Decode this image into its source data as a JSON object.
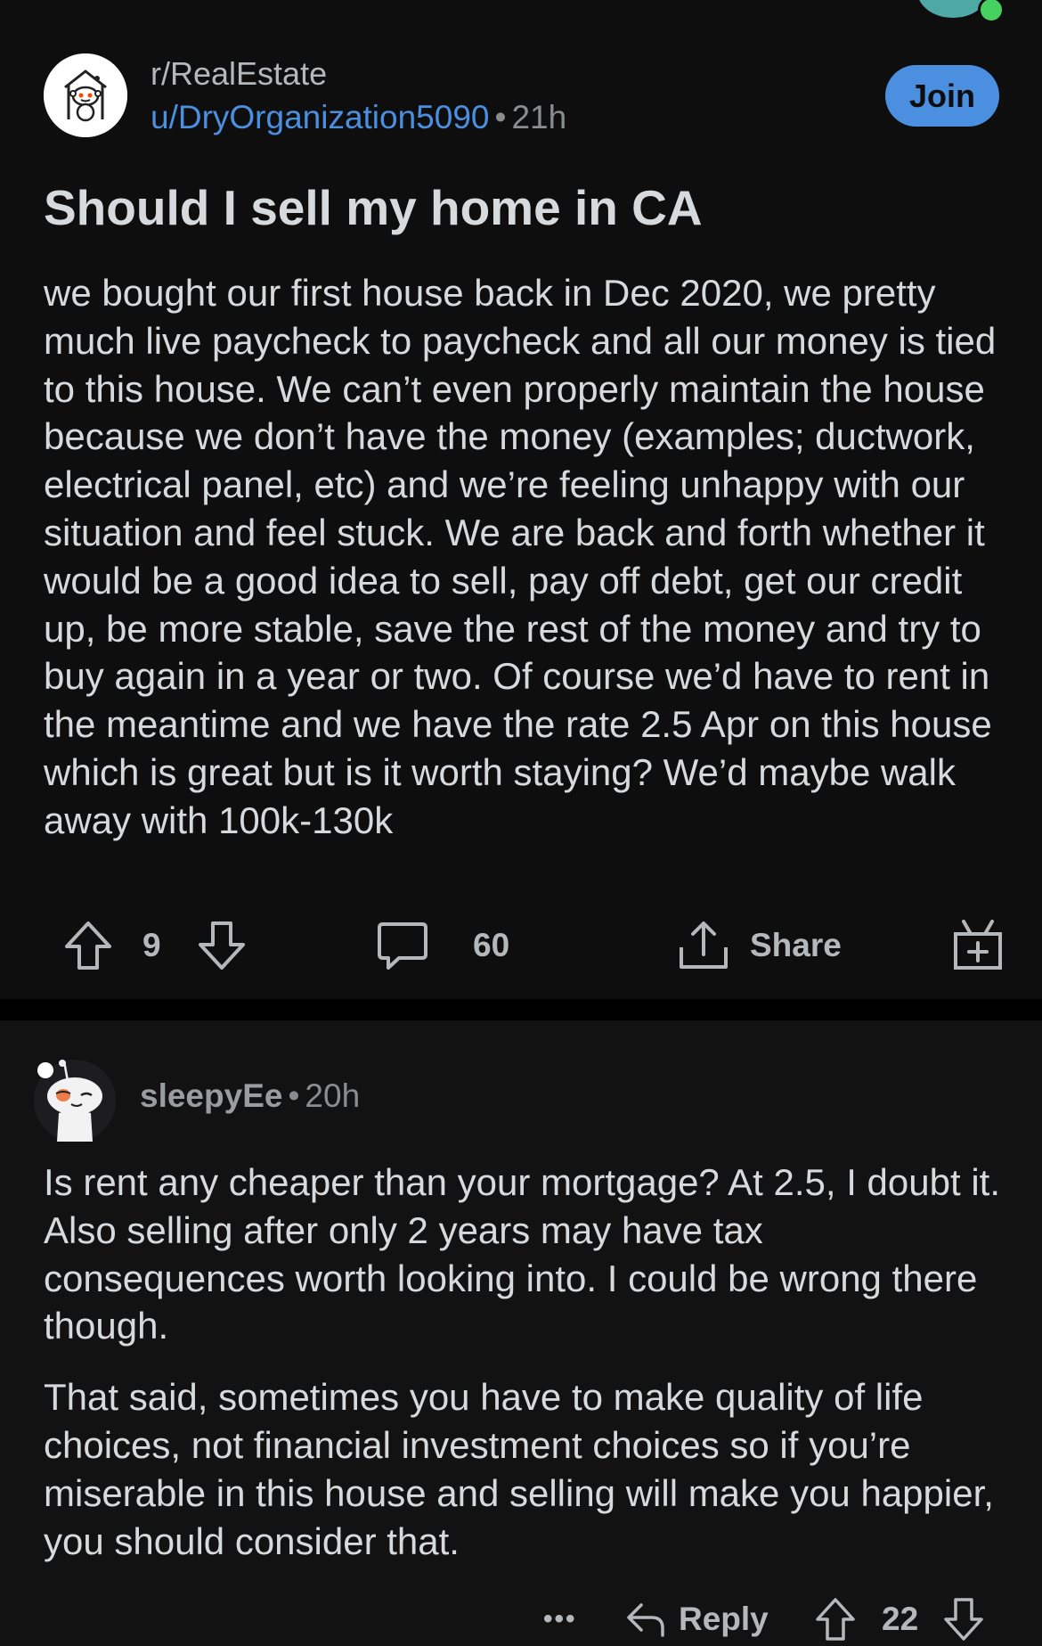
{
  "post": {
    "subreddit": "r/RealEstate",
    "author": "u/DryOrganization5090",
    "separator": "•",
    "age": "21h",
    "join_label": "Join",
    "title": "Should I sell my home in CA",
    "body": "we bought our first house back in Dec 2020, we pretty much live paycheck to paycheck and all our money is tied to this house. We can’t even properly maintain the house because we don’t have the money (examples; ductwork, electrical panel, etc) and we’re feeling unhappy with our situation and feel stuck. We are back and forth whether it would be a good idea to sell, pay off debt, get our credit up, be more stable, save the rest of the money and try to buy again in a year or two. Of course we’d have to rent in the meantime and we have the rate 2.5 Apr on this house which is great but is it worth staying? We’d maybe walk away with 100k-130k",
    "actions": {
      "upvote_icon": "upvote-arrow-icon",
      "vote_count": "9",
      "downvote_icon": "downvote-arrow-icon",
      "comment_icon": "comment-bubble-icon",
      "comment_count": "60",
      "share_icon": "share-icon",
      "share_label": "Share",
      "award_icon": "award-gift-icon"
    }
  },
  "comment": {
    "author": "sleepyEe",
    "separator": "•",
    "age": "20h",
    "paragraphs": [
      "Is rent any cheaper than your mortgage? At 2.5, I doubt it. Also selling after only 2 years may have tax consequences worth looking into. I could be wrong there though.",
      "That said, sometimes you have to make quality of life choices, not financial investment choices so if you’re miserable in this house and selling will make you happier, you should consider that."
    ],
    "actions": {
      "more_label": "•••",
      "reply_label": "Reply",
      "vote_count": "22"
    }
  },
  "colors": {
    "background": "#0e0e0f",
    "text": "#d7dadc",
    "muted": "#8a8d90",
    "accent_blue": "#4a8fe0",
    "online_green": "#46d160"
  }
}
